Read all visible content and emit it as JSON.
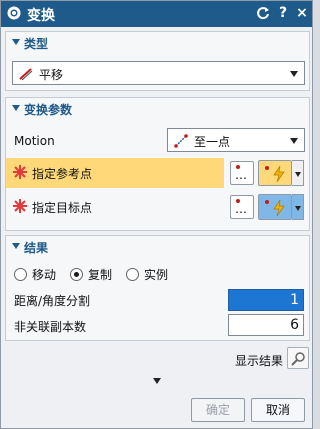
{
  "window": {
    "title": "变换",
    "reset_icon": "reset-icon",
    "help_label": "?",
    "close_label": "×"
  },
  "type_section": {
    "label": "类型",
    "selected": "平移"
  },
  "params_section": {
    "label": "变换参数",
    "motion_label": "Motion",
    "motion_value": "至一点",
    "ref_point_label": "指定参考点",
    "target_point_label": "指定目标点",
    "dots_label": "…"
  },
  "result_section": {
    "label": "结果",
    "options": [
      "移动",
      "复制",
      "实例"
    ],
    "selected_option": "复制",
    "distance_label": "距离/角度分割",
    "distance_value": "1",
    "copies_label": "非关联副本数",
    "copies_value": "6"
  },
  "show_result_label": "显示结果",
  "buttons": {
    "ok": "确定",
    "cancel": "取消"
  },
  "colors": {
    "title_bar": "#1e5a8a",
    "highlight": "#ffd979",
    "required": "#e23b3b",
    "selection": "#1d77d2"
  }
}
